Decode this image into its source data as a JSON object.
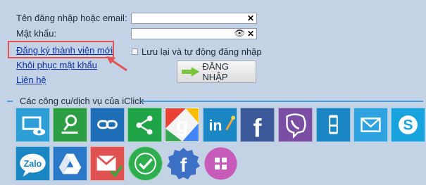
{
  "login": {
    "username_label": "Tên đăng nhập hoặc email:",
    "password_label": "Mật khẩu:",
    "username_value": "",
    "password_value": "",
    "clear_glyph": "✕",
    "show_glyph": "👁"
  },
  "links": {
    "register": "Đăng ký thành viên mới",
    "recover": "Khôi phục mật khẩu",
    "contact": "Liên hệ"
  },
  "remember": {
    "label": "Lưu lại và tự động đăng nhập",
    "checked": false
  },
  "login_button": {
    "label": "ĐĂNG NHẬP"
  },
  "tools_section": {
    "title": "Các công cụ/dịch vụ của iClick"
  },
  "tiles_row1": [
    {
      "name": "screen-view-icon",
      "color": "#2e9fd6"
    },
    {
      "name": "key-search-icon",
      "color": "#2e9e45"
    },
    {
      "name": "link-icon",
      "color": "#1f6fb8"
    },
    {
      "name": "share-icon",
      "color": "#1fa548"
    },
    {
      "name": "google-icon",
      "color": "#e94235"
    },
    {
      "name": "linkedin-icon",
      "color": "#1b86c4"
    },
    {
      "name": "facebook-icon",
      "color": "#3b5998"
    },
    {
      "name": "viber-icon",
      "color": "#7a4fa3"
    },
    {
      "name": "mobile-phone-icon",
      "color": "#1b86c4"
    },
    {
      "name": "mail-icon",
      "color": "#2ea3e0"
    },
    {
      "name": "skype-icon",
      "color": "#19a3de"
    }
  ],
  "tiles_row2": [
    {
      "name": "zalo-icon",
      "label": "Zalo",
      "color": "#1b86c4"
    },
    {
      "name": "google-drive-icon",
      "color": "#2a78c8"
    },
    {
      "name": "gmail-check-icon",
      "color": "#e05151"
    },
    {
      "name": "check-circle-icon",
      "color": "#2eae4e"
    },
    {
      "name": "facebook-badge-icon",
      "color": "#3b70c4"
    },
    {
      "name": "apps-grid-icon",
      "color": "#c75bb9"
    }
  ]
}
